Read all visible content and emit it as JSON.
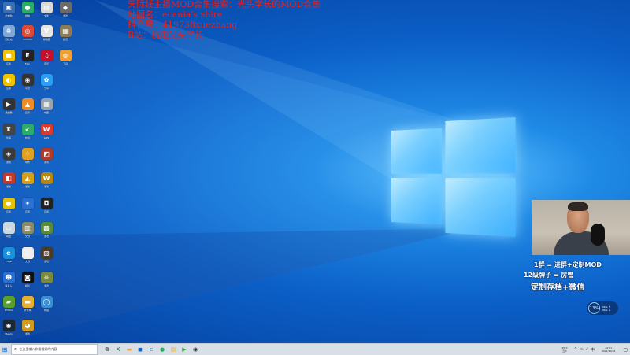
{
  "overlay_text": [
    "天际线主播MOD合集搜索：光头学长的MOD合集",
    "地图名：ecania's shire",
    "抖音号：419738xuezhang",
    "B站：杭电光头学长"
  ],
  "promo": {
    "line1": "1群 = 进群+定制MOD",
    "line2": "12级牌子 = 房管",
    "line3": "定制存档+微信"
  },
  "network_widget": {
    "value": "13%",
    "rates": [
      "0K/s ↑",
      "0K/s ↓"
    ]
  },
  "taskbar": {
    "start_glyph": "⊞",
    "search_placeholder": "在这里输入你要搜索的内容",
    "pinned": [
      {
        "name": "task-view-icon",
        "glyph": "⧉",
        "color": "#333333"
      },
      {
        "name": "excel-icon",
        "glyph": "X",
        "color": "#1e7145"
      },
      {
        "name": "file-explorer-icon",
        "glyph": "▬",
        "color": "#e8a93a"
      },
      {
        "name": "store-icon",
        "glyph": "◼",
        "color": "#0a64c8"
      },
      {
        "name": "edge-icon",
        "glyph": "e",
        "color": "#1a8fdb"
      },
      {
        "name": "wechat-icon",
        "glyph": "●",
        "color": "#2aae67"
      },
      {
        "name": "folder-icon",
        "glyph": "▤",
        "color": "#f0b428"
      },
      {
        "name": "media-icon",
        "glyph": "▶",
        "color": "#3da844"
      },
      {
        "name": "obs-icon",
        "glyph": "◉",
        "color": "#222222"
      }
    ],
    "weather": [
      "20°C",
      "云少"
    ],
    "tray_icons": [
      {
        "name": "chevron-up-icon",
        "glyph": "^"
      },
      {
        "name": "network-icon",
        "glyph": "▭"
      },
      {
        "name": "volume-icon",
        "glyph": "♪"
      },
      {
        "name": "input-method-icon",
        "glyph": "中"
      }
    ],
    "clock": [
      "20:51",
      "2021/10/16"
    ],
    "notification_glyph": "▢"
  },
  "desktop_icons": [
    {
      "name": "this-pc-icon",
      "label": "此电脑",
      "glyph": "▣",
      "color": "#3a6fb5"
    },
    {
      "name": "wechat-icon",
      "label": "微信",
      "glyph": "●",
      "color": "#2aae67"
    },
    {
      "name": "file-icon",
      "label": "文件",
      "glyph": "▤",
      "color": "#d9d9d9"
    },
    {
      "name": "game-icon",
      "label": "游戏",
      "glyph": "◆",
      "color": "#6b6b6b"
    },
    {
      "name": "recycle-bin-icon",
      "label": "回收站",
      "glyph": "♻",
      "color": "#7fa7d9"
    },
    {
      "name": "chrome-icon",
      "label": "Chrome",
      "glyph": "◎",
      "color": "#d94a3a"
    },
    {
      "name": "text-editor-icon",
      "label": "编辑器",
      "glyph": "V",
      "color": "#e6e6e6"
    },
    {
      "name": "wallpaper-icon",
      "label": "壁纸",
      "glyph": "▦",
      "color": "#8a7a5a"
    },
    {
      "name": "app-icon",
      "label": "应用",
      "glyph": "■",
      "color": "#f2c200"
    },
    {
      "name": "epic-games-icon",
      "label": "Epic",
      "glyph": "E",
      "color": "#222222"
    },
    {
      "name": "music-icon",
      "label": "音乐",
      "glyph": "♫",
      "color": "#c8102e"
    },
    {
      "name": "tool-icon",
      "label": "工具",
      "glyph": "◍",
      "color": "#f0a030"
    },
    {
      "name": "app2-icon",
      "label": "应用",
      "glyph": "◐",
      "color": "#f2c200"
    },
    {
      "name": "steam-alt-icon",
      "label": "平台",
      "glyph": "◉",
      "color": "#333333"
    },
    {
      "name": "share-icon",
      "label": "分享",
      "glyph": "✿",
      "color": "#2a9df4"
    },
    {
      "name": "player-icon",
      "label": "播放器",
      "glyph": "▶",
      "color": "#333333"
    },
    {
      "name": "orange-app-icon",
      "label": "应用",
      "glyph": "▲",
      "color": "#f08a24"
    },
    {
      "name": "map-icon",
      "label": "地图",
      "glyph": "▦",
      "color": "#9aa3ad"
    },
    {
      "name": "detective-icon",
      "label": "侦探",
      "glyph": "♜",
      "color": "#444444"
    },
    {
      "name": "green-check-icon",
      "label": "校验",
      "glyph": "✔",
      "color": "#2aae67"
    },
    {
      "name": "wps-icon",
      "label": "WPS",
      "glyph": "W",
      "color": "#d93a2a"
    },
    {
      "name": "game2-icon",
      "label": "游戏",
      "glyph": "◈",
      "color": "#3a3a3a"
    },
    {
      "name": "cities-icon",
      "label": "城市",
      "glyph": "♢",
      "color": "#e0a020"
    },
    {
      "name": "game3-icon",
      "label": "游戏",
      "glyph": "◩",
      "color": "#b03a2a"
    },
    {
      "name": "game4-icon",
      "label": "游戏",
      "glyph": "◧",
      "color": "#c0392b"
    },
    {
      "name": "game5-icon",
      "label": "游戏",
      "glyph": "◭",
      "color": "#d4a017"
    },
    {
      "name": "world-of-warcraft-icon",
      "label": "游戏",
      "glyph": "W",
      "color": "#b8860b"
    },
    {
      "name": "yellow-app-icon",
      "label": "应用",
      "glyph": "●",
      "color": "#e6c200"
    },
    {
      "name": "blue-app-icon",
      "label": "应用",
      "glyph": "✦",
      "color": "#2a6fd4"
    },
    {
      "name": "dark-app-icon",
      "label": "应用",
      "glyph": "◘",
      "color": "#222222"
    },
    {
      "name": "drive-icon",
      "label": "网盘",
      "glyph": "▭",
      "color": "#c9d6e3"
    },
    {
      "name": "doc-icon",
      "label": "文档",
      "glyph": "▥",
      "color": "#8a8a6a"
    },
    {
      "name": "minecraft-icon",
      "label": "游戏",
      "glyph": "▩",
      "color": "#5b8a3a"
    },
    {
      "name": "edge-icon",
      "label": "Edge",
      "glyph": "e",
      "color": "#1a8fdb"
    },
    {
      "name": "blank-doc-icon",
      "label": "文档",
      "glyph": "▯",
      "color": "#eeeeee"
    },
    {
      "name": "game6-icon",
      "label": "游戏",
      "glyph": "▧",
      "color": "#4a3a2a"
    },
    {
      "name": "people-icon",
      "label": "联系人",
      "glyph": "☻",
      "color": "#2a6fd4"
    },
    {
      "name": "camera-icon",
      "label": "相机",
      "glyph": "◙",
      "color": "#111111"
    },
    {
      "name": "skull-game-icon",
      "label": "游戏",
      "glyph": "☠",
      "color": "#7a8a3a"
    },
    {
      "name": "nvidia-icon",
      "label": "NVIDIA",
      "glyph": "▰",
      "color": "#5aa02c"
    },
    {
      "name": "folder-icon",
      "label": "文件夹",
      "glyph": "▬",
      "color": "#e8b030"
    },
    {
      "name": "network-app-icon",
      "label": "网络",
      "glyph": "◯",
      "color": "#3a8fd4"
    },
    {
      "name": "steam-icon",
      "label": "Steam",
      "glyph": "◉",
      "color": "#1b2838"
    },
    {
      "name": "game7-icon",
      "label": "游戏",
      "glyph": "◕",
      "color": "#d49a20"
    },
    {
      "name": "game8-icon",
      "label": "游戏",
      "glyph": "♛",
      "color": "#3a4a8a"
    }
  ]
}
